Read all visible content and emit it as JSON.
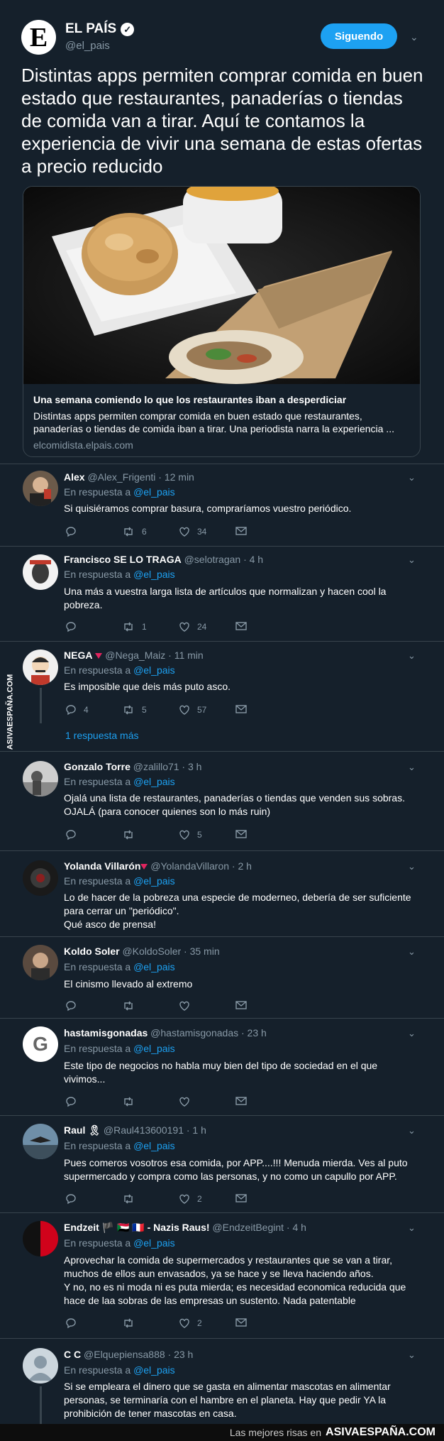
{
  "main_tweet": {
    "logo_letter": "E",
    "name": "EL PAÍS",
    "handle": "@el_pais",
    "follow_label": "Siguendo",
    "text": "Distintas apps permiten comprar comida en buen estado que restaurantes, panaderías o tiendas de comida van a tirar. Aquí te contamos la experiencia de vivir una semana de estas ofertas a precio reducido",
    "card": {
      "title": "Una semana comiendo lo que los restaurantes iban a desperdiciar",
      "description": "Distintas apps permiten comprar comida en buen estado que restaurantes, panaderías o tiendas de comida iban a tirar. Una periodista narra la experiencia ...",
      "url": "elcomidista.elpais.com"
    }
  },
  "in_reply_label": "En respuesta a",
  "in_reply_mention": "@el_pais",
  "replies": [
    {
      "name": "Alex",
      "meta": " @Alex_Frigenti · 12 min",
      "text": "Si quisiéramos comprar basura, compraríamos vuestro periódico.",
      "replies": "",
      "retweets": "6",
      "likes": "34"
    },
    {
      "name": "Francisco SE LO TRAGA",
      "meta": " @selotragan · 4 h",
      "text": "Una más a vuestra larga lista de artículos que normalizan y hacen cool la pobreza.",
      "replies": "",
      "retweets": "1",
      "likes": "24"
    },
    {
      "name": "NEGA",
      "meta": " @Nega_Maiz · 11 min",
      "text": "Es imposible que deis más puto asco.",
      "replies": "4",
      "retweets": "5",
      "likes": "57",
      "more": "1 respuesta más"
    },
    {
      "name": "Gonzalo Torre",
      "meta": " @zalillo71 · 3 h",
      "text": "Ojalá una lista de restaurantes, panaderías o tiendas que venden sus sobras. OJALÁ (para conocer quienes son lo más ruin)",
      "replies": "",
      "retweets": "",
      "likes": "5"
    },
    {
      "name": "Yolanda Villarón",
      "meta": " @YolandaVillaron · 2 h",
      "text": "Lo de hacer de la pobreza una especie de moderneo, debería de ser suficiente para cerrar un \"periódico\".\nQué asco de prensa!",
      "replies": "",
      "retweets": "",
      "likes": ""
    },
    {
      "name": "Koldo Soler",
      "meta": " @KoldoSoler · 35 min",
      "text": "El cinismo llevado al extremo",
      "replies": "",
      "retweets": "",
      "likes": ""
    },
    {
      "name": "hastamisgonadas",
      "meta": " @hastamisgonadas · 23 h",
      "text": "Este tipo de negocios no habla muy bien del tipo de sociedad en el que vivimos...",
      "replies": "",
      "retweets": "",
      "likes": ""
    },
    {
      "name": "Raul 🎗",
      "meta": " @Raul413600191 · 1 h",
      "text": "Pues comeros vosotros esa comida, por APP....!!! Menuda mierda. Ves al puto supermercado y compra como las personas, y no como un capullo por APP.",
      "replies": "",
      "retweets": "",
      "likes": "2"
    },
    {
      "name": "Endzeit 🏴 🇸🇩 🇫🇷 - Nazis Raus!",
      "meta": " @EndzeitBegint · 4 h",
      "text": "Aprovechar la comida de supermercados y restaurantes que se van a tirar, muchos de ellos aun envasados, ya se hace y se lleva haciendo años.\nY no, no es ni moda ni es puta mierda; es necesidad economica reducida que hace de laa sobras de las empresas un sustento. Nada patentable",
      "replies": "",
      "retweets": "",
      "likes": "2"
    },
    {
      "name": "C C",
      "meta": " @Elquepiensa888 · 23 h",
      "text": "Si se empleara el dinero que se gasta en alimentar mascotas en alimentar personas, se terminaría con el hambre en el planeta. Hay que pedir YA la prohibición de tener mascotas en casa.",
      "replies": "",
      "retweets": "",
      "likes": ""
    }
  ],
  "side_watermark": "ASIVAESPAÑA.COM",
  "footer": {
    "text": "Las mejores risas en",
    "brand": "ASIVAESPAÑA.COM"
  },
  "colors": {
    "background": "#15202b",
    "accent": "#1da1f2",
    "muted": "#8899a6",
    "border": "#38444d",
    "warning": "#e0245e"
  }
}
